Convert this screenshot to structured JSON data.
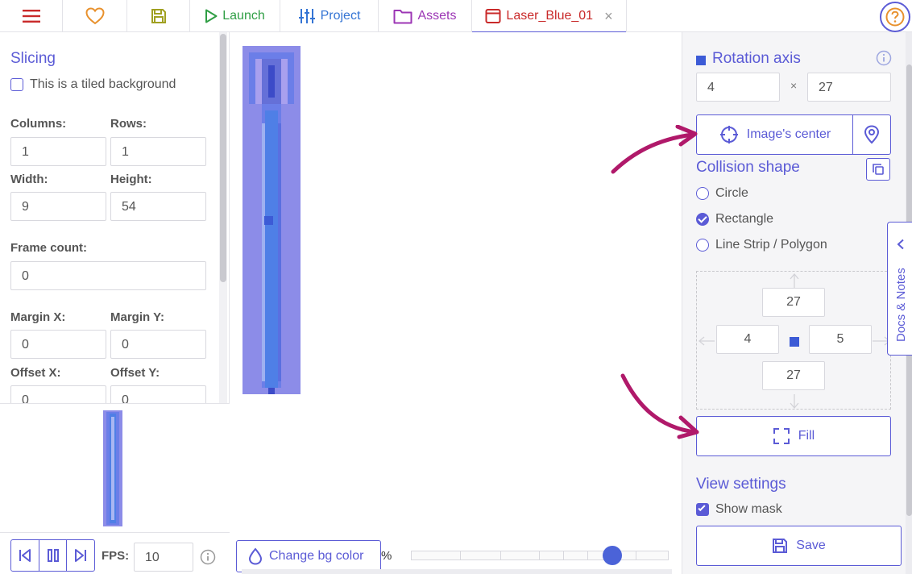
{
  "topbar": {
    "launch_label": "Launch",
    "project_label": "Project",
    "assets_label": "Assets",
    "tab_label": "Laser_Blue_01",
    "tab_close": "×"
  },
  "slicing": {
    "title": "Slicing",
    "tiled_label": "This is a tiled background",
    "columns_label": "Columns:",
    "rows_label": "Rows:",
    "columns": "1",
    "rows": "1",
    "width_label": "Width:",
    "height_label": "Height:",
    "width": "9",
    "height": "54",
    "frame_count_label": "Frame count:",
    "frame_count": "0",
    "margin_x_label": "Margin X:",
    "margin_y_label": "Margin Y:",
    "margin_x": "0",
    "margin_y": "0",
    "offset_x_label": "Offset X:",
    "offset_y_label": "Offset Y:",
    "offset_x": "0",
    "offset_y": "0"
  },
  "playback": {
    "fps_label": "FPS:",
    "fps": "10"
  },
  "canvas": {
    "change_bg_label": "Change bg color",
    "zoom_unit": "%",
    "zoom_fraction": 0.78
  },
  "right": {
    "rotation_title": "Rotation axis",
    "axis_x": "4",
    "axis_sep": "×",
    "axis_y": "27",
    "image_center_label": "Image's center",
    "collision_title": "Collision shape",
    "shapes": [
      {
        "label": "Circle",
        "checked": false
      },
      {
        "label": "Rectangle",
        "checked": true
      },
      {
        "label": "Line Strip / Polygon",
        "checked": false
      }
    ],
    "rect_top": "27",
    "rect_left": "4",
    "rect_right": "5",
    "rect_bottom": "27",
    "fill_label": "Fill",
    "view_title": "View settings",
    "show_mask_label": "Show mask",
    "save_label": "Save",
    "docs_label": "Docs & Notes"
  },
  "colors": {
    "accent": "#5b5bd6",
    "annotation_arrow": "#b0196a",
    "sprite_outer": "#8c8ce8",
    "sprite_core": "#4f7fe6"
  }
}
